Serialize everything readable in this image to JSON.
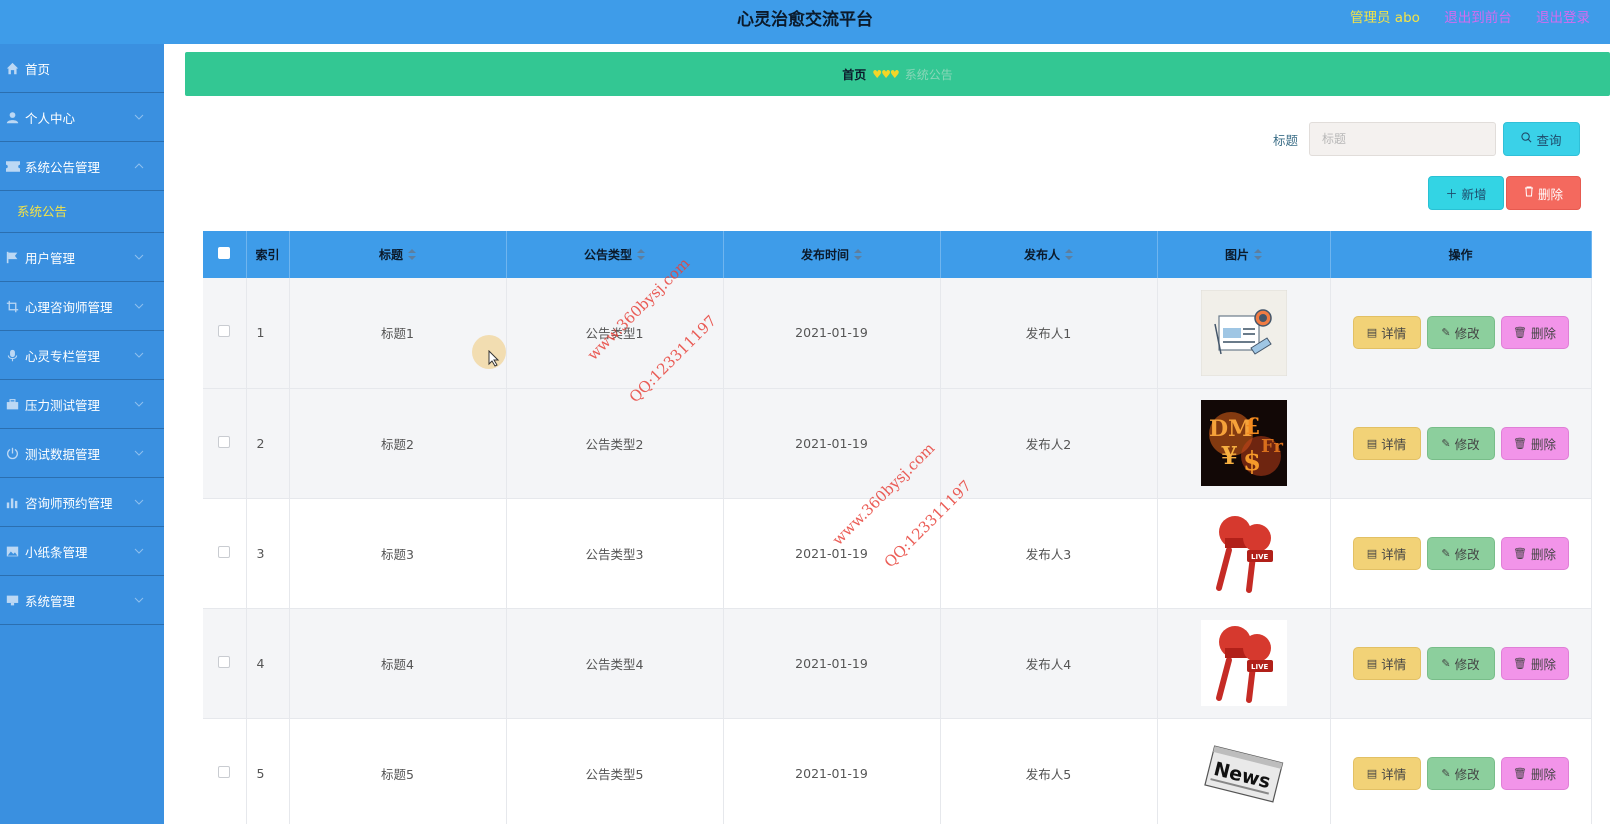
{
  "header": {
    "app_title": "心灵治愈交流平台",
    "admin_label": "管理员 abo",
    "to_front": "退出到前台",
    "logout": "退出登录"
  },
  "sidebar": {
    "items": [
      {
        "label": "首页",
        "icon": "home-icon"
      },
      {
        "label": "个人中心",
        "icon": "user-icon"
      },
      {
        "label": "系统公告管理",
        "icon": "ticket-icon",
        "expanded": true
      },
      {
        "label": "用户管理",
        "icon": "flag-icon"
      },
      {
        "label": "心理咨询师管理",
        "icon": "crop-icon"
      },
      {
        "label": "心灵专栏管理",
        "icon": "mic-icon"
      },
      {
        "label": "压力测试管理",
        "icon": "briefcase-icon"
      },
      {
        "label": "测试数据管理",
        "icon": "power-icon"
      },
      {
        "label": "咨询师预约管理",
        "icon": "bar-chart-icon"
      },
      {
        "label": "小纸条管理",
        "icon": "picture-icon"
      },
      {
        "label": "系统管理",
        "icon": "monitor-icon"
      }
    ],
    "sub_item": "系统公告"
  },
  "breadcrumb": {
    "home": "首页",
    "separator": "♥♥♥",
    "current": "系统公告"
  },
  "search": {
    "label": "标题",
    "placeholder": "标题",
    "query_button": "查询"
  },
  "actions": {
    "add_button": "新增",
    "delete_button": "删除"
  },
  "table": {
    "columns": [
      "索引",
      "标题",
      "公告类型",
      "发布时间",
      "发布人",
      "图片",
      "操作"
    ],
    "rows": [
      {
        "index": "1",
        "title": "标题1",
        "type": "公告类型1",
        "time": "2021-01-19",
        "publisher": "发布人1",
        "image": "news-illustration"
      },
      {
        "index": "2",
        "title": "标题2",
        "type": "公告类型2",
        "time": "2021-01-19",
        "publisher": "发布人2",
        "image": "money-symbols"
      },
      {
        "index": "3",
        "title": "标题3",
        "type": "公告类型3",
        "time": "2021-01-19",
        "publisher": "发布人3",
        "image": "live-microphones"
      },
      {
        "index": "4",
        "title": "标题4",
        "type": "公告类型4",
        "time": "2021-01-19",
        "publisher": "发布人4",
        "image": "live-microphones"
      },
      {
        "index": "5",
        "title": "标题5",
        "type": "公告类型5",
        "time": "2021-01-19",
        "publisher": "发布人5",
        "image": "newspaper"
      }
    ],
    "row_actions": {
      "detail": "详情",
      "edit": "修改",
      "delete": "删除"
    }
  },
  "watermark": {
    "site": "www.360bysj.com",
    "qq": "QQ:123311197"
  },
  "colors": {
    "header": "#3e9ce9",
    "sidebar": "#3a90e0",
    "breadcrumb": "#33c793",
    "accent_yellow": "#f4e347"
  }
}
